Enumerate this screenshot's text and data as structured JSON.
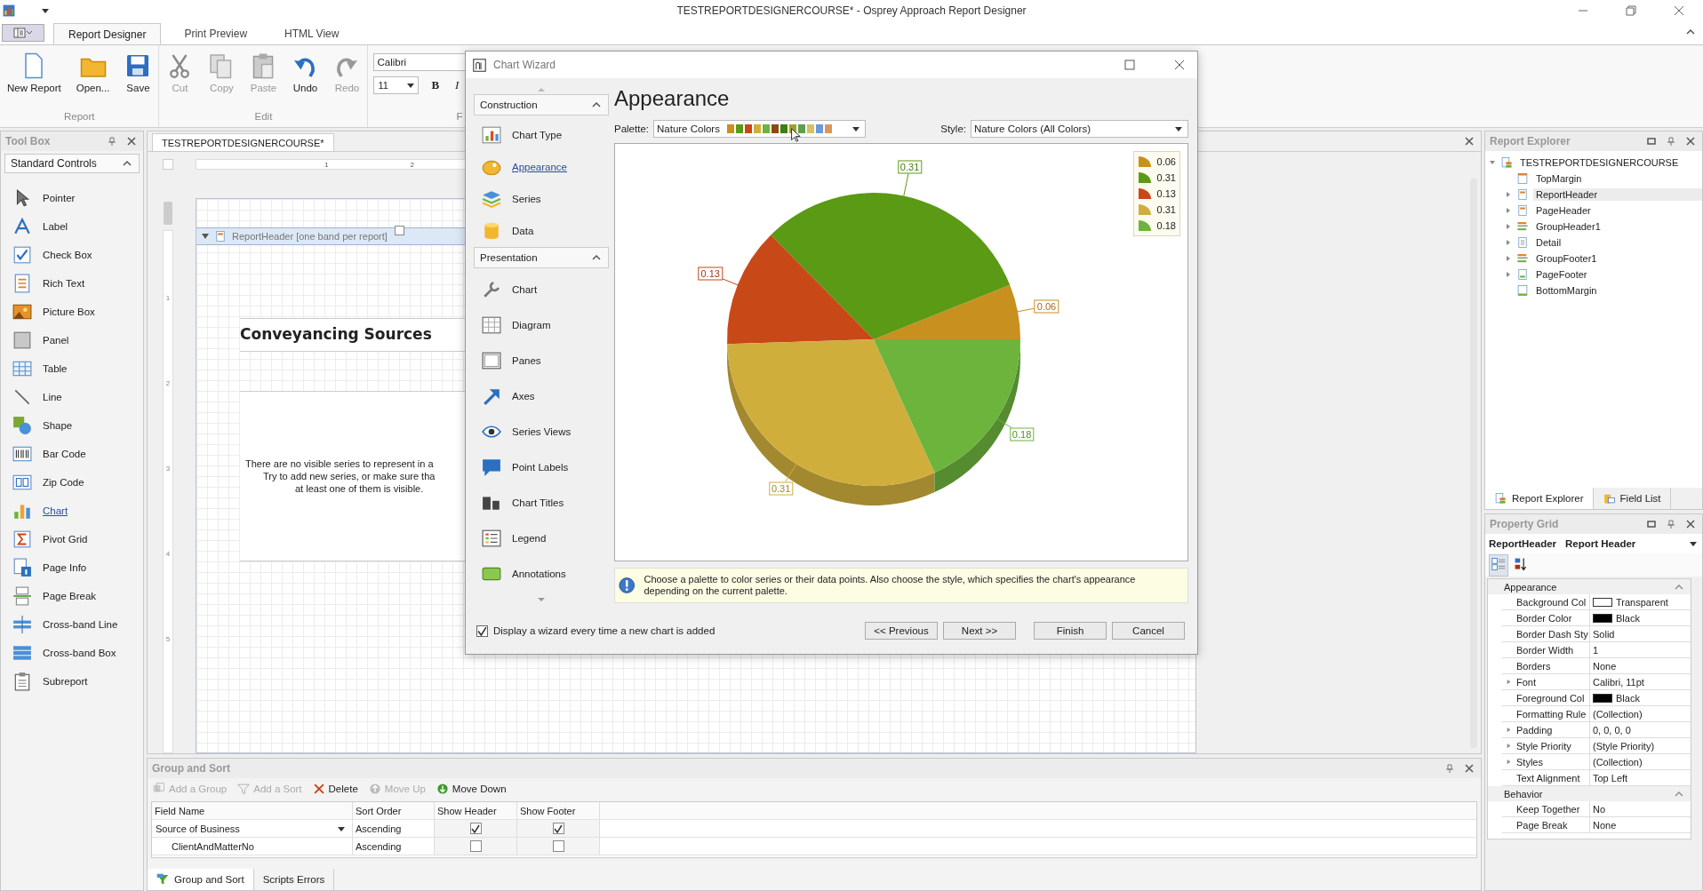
{
  "app": {
    "title": "TESTREPORTDESIGNERCOURSE* - Osprey Approach Report Designer"
  },
  "ribbon_tabs": [
    {
      "label": "Report Designer",
      "selected": true
    },
    {
      "label": "Print Preview",
      "selected": false
    },
    {
      "label": "HTML View",
      "selected": false
    }
  ],
  "ribbon_groups": [
    {
      "label": "Report",
      "buttons": [
        {
          "label": "New Report",
          "kind": "page",
          "disabled": false
        },
        {
          "label": "Open...",
          "kind": "folder",
          "disabled": false
        },
        {
          "label": "Save",
          "kind": "floppy",
          "disabled": false
        }
      ]
    },
    {
      "label": "Edit",
      "buttons": [
        {
          "label": "Cut",
          "kind": "scissors",
          "disabled": true
        },
        {
          "label": "Copy",
          "kind": "copy",
          "disabled": true
        },
        {
          "label": "Paste",
          "kind": "paste",
          "disabled": true
        },
        {
          "label": "Undo",
          "kind": "undo",
          "disabled": false
        },
        {
          "label": "Redo",
          "kind": "redo",
          "disabled": true
        }
      ]
    }
  ],
  "font_group": {
    "label": "F",
    "font": "Calibri",
    "size": "11",
    "bold": "B",
    "italic": "I"
  },
  "toolbox": {
    "title": "Tool Box",
    "group": "Standard Controls",
    "items": [
      {
        "label": "Pointer",
        "kind": "pointer",
        "hovered": false
      },
      {
        "label": "Label",
        "kind": "label",
        "hovered": false
      },
      {
        "label": "Check Box",
        "kind": "checkbox",
        "hovered": false
      },
      {
        "label": "Rich Text",
        "kind": "richtext",
        "hovered": false
      },
      {
        "label": "Picture Box",
        "kind": "picture",
        "hovered": false
      },
      {
        "label": "Panel",
        "kind": "panel",
        "hovered": false
      },
      {
        "label": "Table",
        "kind": "table",
        "hovered": false
      },
      {
        "label": "Line",
        "kind": "line",
        "hovered": false
      },
      {
        "label": "Shape",
        "kind": "shape",
        "hovered": false
      },
      {
        "label": "Bar Code",
        "kind": "barcode",
        "hovered": false
      },
      {
        "label": "Zip Code",
        "kind": "zipcode",
        "hovered": false
      },
      {
        "label": "Chart",
        "kind": "chart",
        "hovered": true
      },
      {
        "label": "Pivot Grid",
        "kind": "pivot",
        "hovered": false
      },
      {
        "label": "Page Info",
        "kind": "pageinfo",
        "hovered": false
      },
      {
        "label": "Page Break",
        "kind": "pagebreak",
        "hovered": false
      },
      {
        "label": "Cross-band Line",
        "kind": "crossline",
        "hovered": false
      },
      {
        "label": "Cross-band Box",
        "kind": "crossbox",
        "hovered": false
      },
      {
        "label": "Subreport",
        "kind": "subreport",
        "hovered": false
      }
    ]
  },
  "document": {
    "tab": "TESTREPORTDESIGNERCOURSE*",
    "ruler_marks": [
      "1",
      "2"
    ],
    "vertical_ruler_marks": [
      "1",
      "2",
      "3",
      "4",
      "5"
    ],
    "band": "ReportHeader [one band per report]",
    "heading": "Conveyancing Sources",
    "chart_placeholder": [
      "There are no visible series to represent in a",
      "Try to add new series, or make sure tha",
      "at least one of them is visible."
    ]
  },
  "group_sort": {
    "title": "Group and Sort",
    "toolbar": [
      {
        "label": "Add a Group",
        "kind": "group",
        "disabled": true
      },
      {
        "label": "Add a Sort",
        "kind": "sort",
        "disabled": true
      },
      {
        "label": "Delete",
        "kind": "delete",
        "disabled": false
      },
      {
        "label": "Move Up",
        "kind": "up",
        "disabled": true
      },
      {
        "label": "Move Down",
        "kind": "down",
        "disabled": false
      }
    ],
    "columns": [
      "Field Name",
      "Sort Order",
      "Show Header",
      "Show Footer"
    ],
    "rows": [
      {
        "field": "Source of Business",
        "sort": "Ascending",
        "show_header": true,
        "show_footer": true,
        "selected": true,
        "children": [
          {
            "field": "ClientAndMatterNo",
            "sort": "Ascending",
            "show_header": false,
            "show_footer": false,
            "selected": false
          }
        ]
      }
    ],
    "tabs": [
      {
        "label": "Group and Sort",
        "kind": "groupsort",
        "selected": true
      },
      {
        "label": "Scripts Errors",
        "kind": "none",
        "selected": false
      }
    ]
  },
  "report_explorer": {
    "title": "Report Explorer",
    "tree": [
      {
        "label": "TESTREPORTDESIGNERCOURSE",
        "kind": "report",
        "expanded": true,
        "selected": false,
        "children": [
          {
            "label": "TopMargin",
            "kind": "top",
            "selected": false
          },
          {
            "label": "ReportHeader",
            "kind": "header",
            "expanded": false,
            "selected": true
          },
          {
            "label": "PageHeader",
            "kind": "header",
            "expanded": false,
            "selected": false
          },
          {
            "label": "GroupHeader1",
            "kind": "group",
            "expanded": false,
            "selected": false
          },
          {
            "label": "Detail",
            "kind": "detail",
            "expanded": false,
            "selected": false
          },
          {
            "label": "GroupFooter1",
            "kind": "group",
            "expanded": false,
            "selected": false
          },
          {
            "label": "PageFooter",
            "kind": "footer",
            "expanded": false,
            "selected": false
          },
          {
            "label": "BottomMargin",
            "kind": "bottom",
            "selected": false
          }
        ]
      }
    ],
    "tabs": [
      {
        "label": "Report Explorer",
        "kind": "report",
        "selected": true
      },
      {
        "label": "Field List",
        "kind": "fields",
        "selected": false
      }
    ]
  },
  "property_grid": {
    "title": "Property Grid",
    "object_name": "ReportHeader",
    "object_type": "Report Header",
    "view_buttons": [
      {
        "kind": "categorized",
        "selected": true
      },
      {
        "kind": "alphabetical",
        "selected": false
      }
    ],
    "categories": [
      {
        "label": "Appearance",
        "expanded": true,
        "properties": [
          {
            "name": "Background Col",
            "value": "Transparent",
            "color": "#ffffff"
          },
          {
            "name": "Border Color",
            "value": "Black",
            "color": "#000000"
          },
          {
            "name": "Border Dash Sty",
            "value": "Solid"
          },
          {
            "name": "Border Width",
            "value": "1"
          },
          {
            "name": "Borders",
            "value": "None"
          },
          {
            "name": "Font",
            "value": "Calibri, 11pt",
            "expanded": false
          },
          {
            "name": "Foreground Col",
            "value": "Black",
            "color": "#000000"
          },
          {
            "name": "Formatting Rule",
            "value": "(Collection)"
          },
          {
            "name": "Padding",
            "value": "0, 0, 0, 0",
            "expanded": false
          },
          {
            "name": "Style Priority",
            "value": "(Style Priority)",
            "expanded": false
          },
          {
            "name": "Styles",
            "value": "(Collection)",
            "expanded": false
          },
          {
            "name": "Text Alignment",
            "value": "Top Left"
          }
        ]
      },
      {
        "label": "Behavior",
        "expanded": true,
        "properties": [
          {
            "name": "Keep Together",
            "value": "No"
          },
          {
            "name": "Page Break",
            "value": "None"
          }
        ]
      }
    ]
  },
  "wizard": {
    "title": "Chart Wizard",
    "sections": [
      {
        "label": "Construction",
        "expanded": true,
        "items": [
          {
            "label": "Chart Type",
            "kind": "charttype",
            "selected": false
          },
          {
            "label": "Appearance",
            "kind": "appearance",
            "selected": true
          },
          {
            "label": "Series",
            "kind": "series",
            "selected": false
          },
          {
            "label": "Data",
            "kind": "data",
            "selected": false
          }
        ]
      },
      {
        "label": "Presentation",
        "expanded": true,
        "items": [
          {
            "label": "Chart",
            "kind": "wrench",
            "selected": false
          },
          {
            "label": "Diagram",
            "kind": "diagram",
            "selected": false
          },
          {
            "label": "Panes",
            "kind": "panes",
            "selected": false
          },
          {
            "label": "Axes",
            "kind": "axes",
            "selected": false
          },
          {
            "label": "Series Views",
            "kind": "views",
            "selected": false
          },
          {
            "label": "Point Labels",
            "kind": "labels",
            "selected": false
          },
          {
            "label": "Chart Titles",
            "kind": "titles",
            "selected": false
          },
          {
            "label": "Legend",
            "kind": "legend",
            "selected": false
          },
          {
            "label": "Annotations",
            "kind": "annotations",
            "selected": false
          }
        ]
      }
    ],
    "heading": "Appearance",
    "palette": {
      "label": "Palette:",
      "value": "Nature Colors",
      "swatches": [
        {
          "color": "#c8901e"
        },
        {
          "color": "#5a9a14"
        },
        {
          "color": "#c84818"
        },
        {
          "color": "#d0ae3c"
        },
        {
          "color": "#6cb43c"
        },
        {
          "color": "#8c4814"
        },
        {
          "color": "#3d7e0e"
        },
        {
          "color": "#a0a030"
        },
        {
          "color": "#5ca050"
        },
        {
          "color": "#d8c060"
        },
        {
          "color": "#6a9ad8"
        },
        {
          "color": "#d8985a"
        }
      ]
    },
    "style": {
      "label": "Style:",
      "value": "Nature Colors (All Colors)"
    },
    "chart": {
      "chart_data": {
        "type": "pie",
        "values": [
          0.06,
          0.31,
          0.13,
          0.31,
          0.18
        ],
        "data_labels": true
      },
      "legend": [
        "0.06",
        "0.31",
        "0.13",
        "0.31",
        "0.18"
      ]
    },
    "hint": "Choose a palette to color series or their data points. Also choose the style, which specifies the chart's appearance depending on the current palette.",
    "show_wizard": {
      "label": "Display a wizard every time a new chart is added",
      "checked": true
    },
    "buttons": [
      "<< Previous",
      "Next >>",
      "Finish",
      "Cancel"
    ]
  }
}
